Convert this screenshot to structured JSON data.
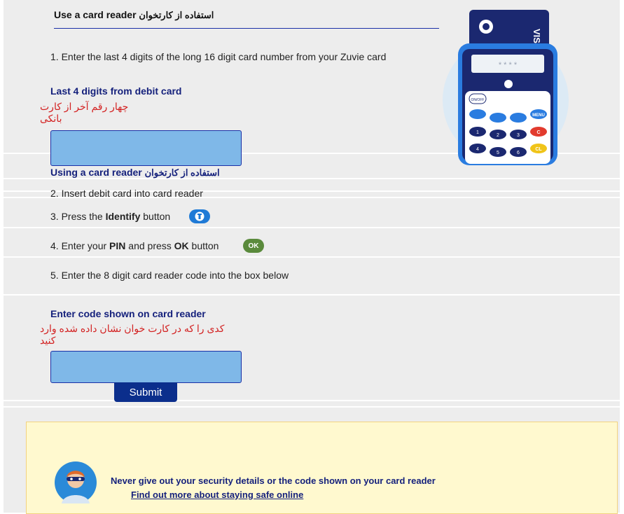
{
  "heading": {
    "title": "Use a card reader",
    "title_fa": "استفاده از کارتخوان"
  },
  "steps": {
    "step1": "1. Enter the last 4 digits of the long 16 digit card number from your Zuvie card",
    "step2": "2. Insert debit card into card reader",
    "step3_pre": "3. Press the ",
    "step3_bold": "Identify",
    "step3_post": " button",
    "step4_pre": "4. Enter your ",
    "step4_pin": "PIN",
    "step4_mid": " and press ",
    "step4_ok": "OK",
    "step4_post": " button",
    "step4_badge": "OK",
    "step5": "5. Enter the 8 digit card reader code into the box below"
  },
  "card_field": {
    "label": "Last 4 digits from debit card",
    "label_fa": "چهار رقم آخر از کارت بانکی",
    "value": ""
  },
  "reader_section": {
    "title": "Using a card reader",
    "title_fa": "استفاده از کارتخوان"
  },
  "code_field": {
    "label": "Enter code shown on card reader",
    "label_fa": "کدی را که در کارت خوان نشان داده شده وارد کنید",
    "value": ""
  },
  "submit_label": "Submit",
  "safety": {
    "message": "Never give out your security details or the code shown on your card reader",
    "link": "Find out more about staying safe online"
  },
  "reader_image": {
    "card_brand": "VISA",
    "screen_text": "* * * *",
    "key_onoff": "ON/OFF",
    "key_menu": "MENU",
    "key_c": "C",
    "key_cl": "CL",
    "key_1": "1",
    "key_2": "2",
    "key_3": "3",
    "key_4": "4",
    "key_5": "5",
    "key_6": "6"
  }
}
